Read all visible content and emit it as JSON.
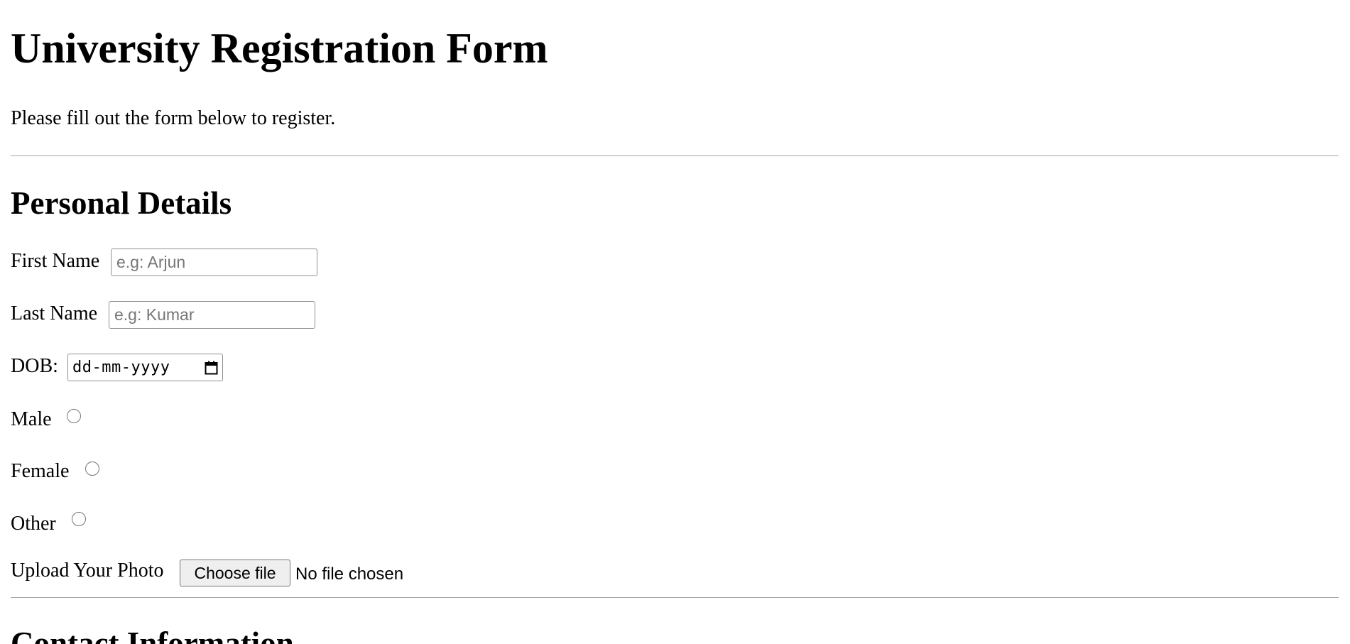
{
  "page": {
    "title": "University Registration Form",
    "subtitle": "Please fill out the form below to register."
  },
  "personal": {
    "heading": "Personal Details",
    "first_name": {
      "label": "First Name",
      "value": "",
      "placeholder": "e.g: Arjun"
    },
    "last_name": {
      "label": "Last Name",
      "value": "",
      "placeholder": "e.g: Kumar"
    },
    "dob": {
      "label": "DOB:",
      "placeholder": "dd-mm-yyyy",
      "icon": "calendar-icon"
    },
    "gender": [
      {
        "label": "Male",
        "checked": false
      },
      {
        "label": "Female",
        "checked": false
      },
      {
        "label": "Other",
        "checked": false
      }
    ],
    "photo": {
      "label": "Upload Your Photo",
      "button_label": "Choose file",
      "status": "No file chosen"
    }
  },
  "contact": {
    "heading": "Contact Information"
  },
  "colors": {
    "background": "#ffffff",
    "text": "#000000",
    "rule": "#a6a6a6",
    "input_border": "#8f8f8f",
    "placeholder": "#767676",
    "button_bg": "#efefef"
  }
}
